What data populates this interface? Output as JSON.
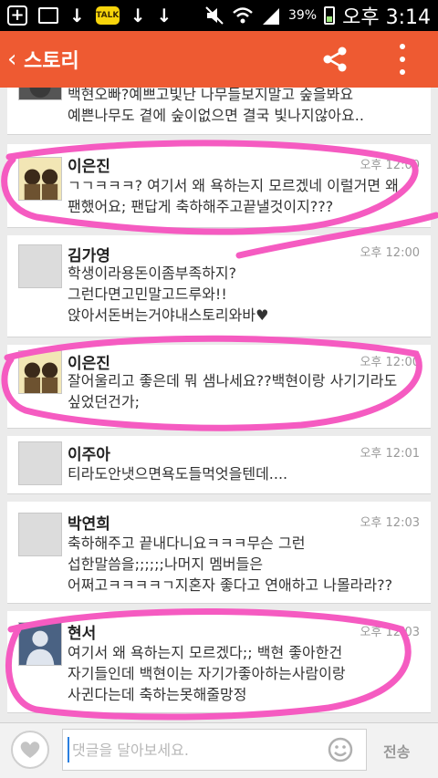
{
  "status_bar": {
    "kakao_label": "TALK",
    "battery": "39%",
    "time": "오후 3:14"
  },
  "app_bar": {
    "back": "‹",
    "title": "스토리"
  },
  "comments": [
    {
      "name": "",
      "time": "",
      "text": "백현오빠?예쁘고빛난 나무들보지말고 숲을봐요\n예쁜나무도 곁에 숲이없으면 결국 빛나지않아요.."
    },
    {
      "name": "이은진",
      "time": "오후 12:00",
      "text": "ㄱㄱㅋㅋㅋ? 여기서 왜 욕하는지 모르겠네 이럴거면 왜\n팬했어요; 팬답게 축하해주고끝낼것이지???"
    },
    {
      "name": "김가영",
      "time": "오후 12:00",
      "text": "학생이라용돈이좀부족하지?\n그런다면고민말고드루와!!\n앉아서돈버는거야내스토리와바♥"
    },
    {
      "name": "이은진",
      "time": "오후 12:00",
      "text": "잘어울리고 좋은데 뭐 샘나세요??백현이랑 사기기라도\n싶었던건가;"
    },
    {
      "name": "이주아",
      "time": "오후 12:01",
      "text": "티라도안냇으면욕도들먹엇을텐데...."
    },
    {
      "name": "박연희",
      "time": "오후 12:03",
      "text": "축하해주고 끝내다니요ㅋㅋㅋ무슨 그런\n섭한말씀을;;;;;;나머지 멤버들은\n어쩌고ㅋㅋㅋㅋㄱ지혼자 좋다고 연애하고 나몰라라??"
    },
    {
      "name": "현서",
      "time": "오후 12:03",
      "text": "여기서 왜 욕하는지 모르겠다;; 백현 좋아한건\n자기들인데 백현이는 자기가좋아하는사람이랑\n사귄다는데 축하는못해줄망정"
    }
  ],
  "input_bar": {
    "placeholder": "댓글을 달아보세요.",
    "send_label": "전송"
  },
  "colors": {
    "app_bar": "#ee5a32",
    "highlight_marker": "#f55bc1"
  }
}
